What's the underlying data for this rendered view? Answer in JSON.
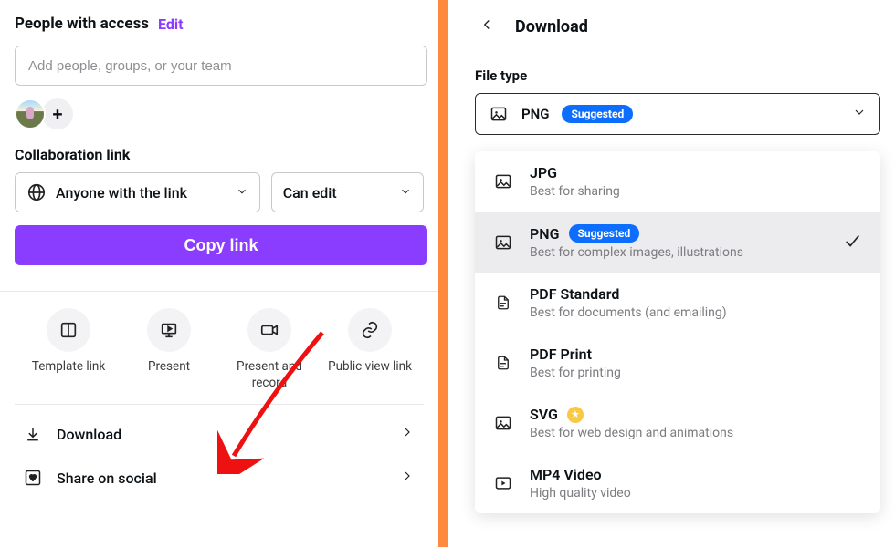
{
  "access": {
    "title": "People with access",
    "edit_label": "Edit"
  },
  "add_people": {
    "placeholder": "Add people, groups, or your team"
  },
  "collab": {
    "label": "Collaboration link",
    "scope_label": "Anyone with the link",
    "perm_label": "Can edit",
    "copy_label": "Copy link"
  },
  "share_icons": {
    "template": "Template link",
    "present": "Present",
    "present_record": "Present and record",
    "public": "Public view link"
  },
  "list": {
    "download": "Download",
    "share_social": "Share on social"
  },
  "download_panel": {
    "title": "Download",
    "filetype_label": "File type",
    "suggested": "Suggested",
    "selected": "PNG",
    "options": [
      {
        "name": "JPG",
        "desc": "Best for sharing"
      },
      {
        "name": "PNG",
        "desc": "Best for complex images, illustrations",
        "suggested": true,
        "selected": true
      },
      {
        "name": "PDF Standard",
        "desc": "Best for documents (and emailing)"
      },
      {
        "name": "PDF Print",
        "desc": "Best for printing"
      },
      {
        "name": "SVG",
        "desc": "Best for web design and animations",
        "premium": true
      },
      {
        "name": "MP4 Video",
        "desc": "High quality video"
      }
    ]
  }
}
